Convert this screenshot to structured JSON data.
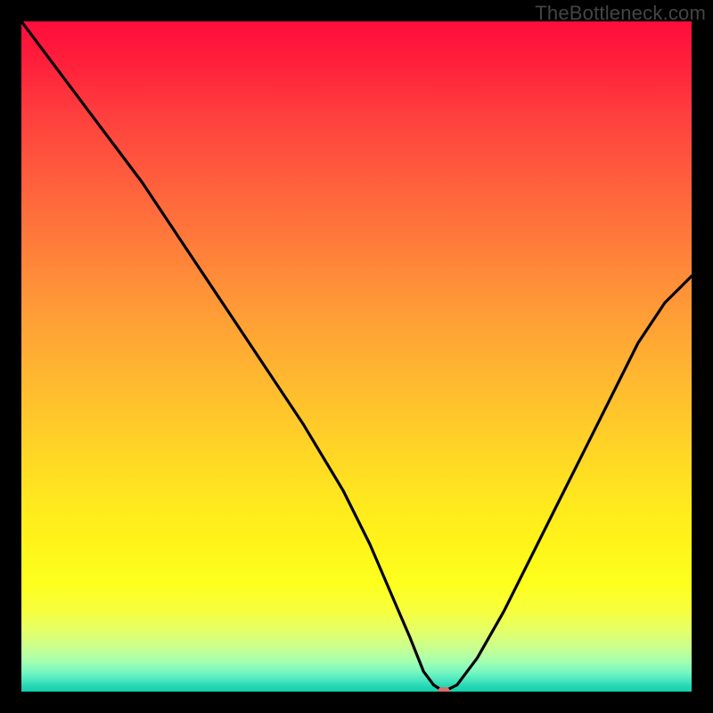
{
  "watermark": "TheBottleneck.com",
  "colors": {
    "frame_bg": "#000000",
    "curve_stroke": "#000000",
    "marker_fill": "#d96e6b"
  },
  "chart_data": {
    "type": "line",
    "title": "",
    "xlabel": "",
    "ylabel": "",
    "xlim": [
      0,
      100
    ],
    "ylim": [
      0,
      100
    ],
    "series": [
      {
        "name": "bottleneck-curve",
        "x": [
          0,
          6,
          12,
          18,
          24,
          30,
          36,
          42,
          48,
          52,
          55,
          58,
          60,
          61.5,
          63,
          65,
          68,
          72,
          76,
          80,
          84,
          88,
          92,
          96,
          100
        ],
        "values": [
          100,
          92,
          84,
          76,
          67,
          58,
          49,
          40,
          30,
          22,
          15,
          8,
          3,
          1,
          0,
          1,
          5,
          12,
          20,
          28,
          36,
          44,
          52,
          58,
          62
        ]
      }
    ],
    "marker": {
      "x": 63,
      "y": 0
    },
    "gradient_note": "vertical rainbow red→orange→yellow→green, green band compressed at bottom",
    "grid": false,
    "legend": false
  }
}
